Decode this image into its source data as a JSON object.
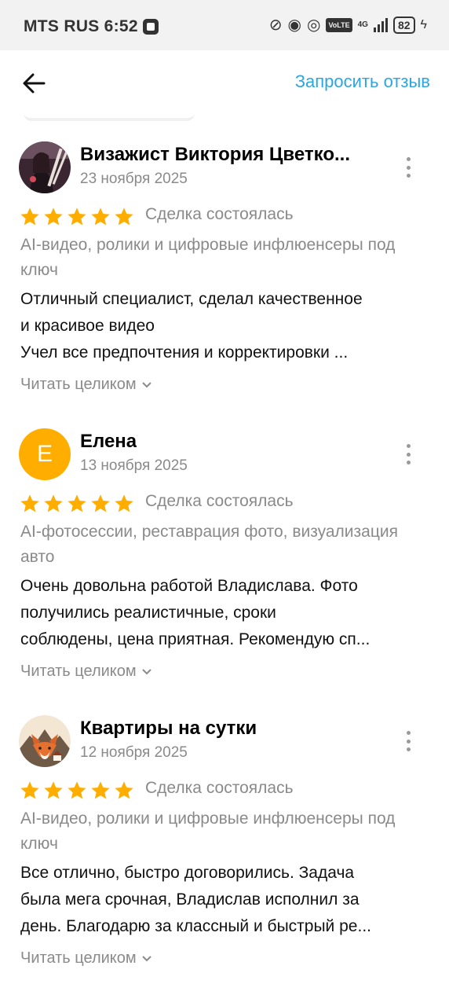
{
  "status_bar": {
    "carrier": "MTS RUS",
    "time": "6:52",
    "volte": "VoLTE",
    "network": "4G",
    "battery": "82"
  },
  "header": {
    "request_review_label": "Запросить отзыв"
  },
  "colors": {
    "accent": "#2aa7e0",
    "star": "#ffae00",
    "muted_text": "#8a8a8a"
  },
  "reviews": [
    {
      "author": "Визажист Виктория Цветко...",
      "date": "23 ноября 2025",
      "rating": 5,
      "deal_status": "Сделка состоялась",
      "service": "AI-видео, ролики и цифровые инфлюенсеры под ключ",
      "text_lines": [
        "Отличный специалист, сделал качественное",
        "и красивое видео",
        "Учел все предпочтения и корректировки ..."
      ],
      "read_more": "Читать целиком"
    },
    {
      "author": "Елена",
      "avatar_letter": "Е",
      "date": "13 ноября 2025",
      "rating": 5,
      "deal_status": "Сделка состоялась",
      "service": "AI-фотосессии, реставрация фото, визуализация авто",
      "text_lines": [
        "Очень довольна работой Владислава. Фото",
        "получились реалистичные, сроки",
        "соблюдены, цена приятная. Рекомендую сп..."
      ],
      "read_more": "Читать целиком"
    },
    {
      "author": "Квартиры на сутки",
      "date": "12 ноября 2025",
      "rating": 5,
      "deal_status": "Сделка состоялась",
      "service": "AI-видео, ролики и цифровые инфлюенсеры под ключ",
      "text_lines": [
        "Все отлично, быстро договорились.  Задача",
        "была мега срочная, Владислав исполнил за",
        "день. Благодарю за классный и быстрый ре..."
      ],
      "read_more": "Читать целиком"
    }
  ]
}
